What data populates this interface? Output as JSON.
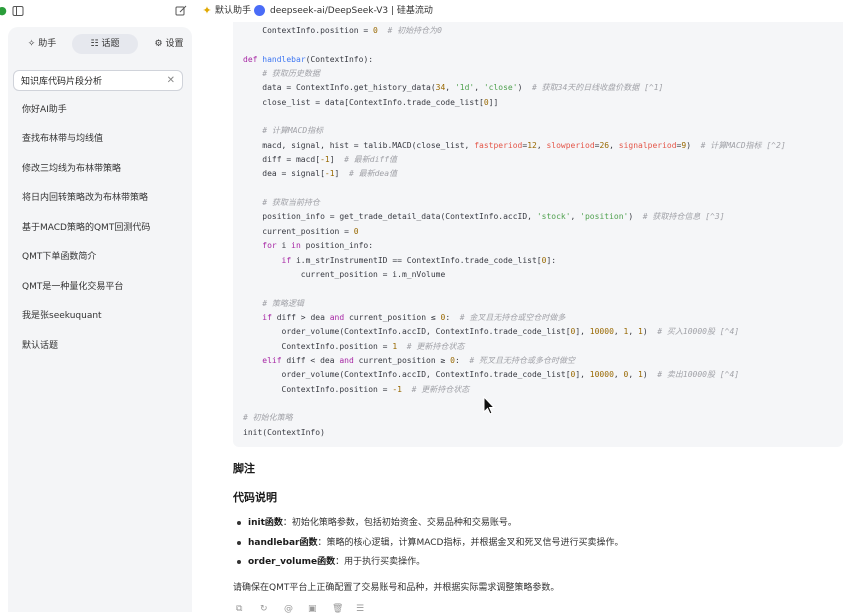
{
  "topbar": {
    "items": [
      {
        "icon": "edit-icon",
        "label": ""
      },
      {
        "icon": "star-icon",
        "label": "默认助手"
      },
      {
        "icon": "deepseek-logo-icon",
        "label": "deepseek-ai/DeepSeek-V3 | 硅基流动"
      }
    ]
  },
  "sidebar": {
    "tabs": [
      {
        "icon": "sparkle-icon",
        "label": "助手"
      },
      {
        "icon": "list-icon",
        "label": "话题"
      },
      {
        "icon": "gear-icon",
        "label": "设置"
      }
    ],
    "search": {
      "value": "知识库代码片段分析"
    },
    "conversations": [
      "你好AI助手",
      "查找布林带与均线值",
      "修改三均线为布林带策略",
      "将日内回转策略改为布林带策略",
      "基于MACD策略的QMT回测代码",
      "QMT下单函数简介",
      "QMT是一种量化交易平台",
      "我是张seekuquant",
      "默认话题"
    ]
  },
  "main": {
    "code_lines": [
      "    ContextInfo.position = 0  # 初始持仓为0",
      "",
      "def handlebar(ContextInfo):",
      "    # 获取历史数据",
      "    data = ContextInfo.get_history_data(34, '1d', 'close')  # 获取34天的日线收盘价数据 [^1]",
      "    close_list = data[ContextInfo.trade_code_list[0]]",
      "",
      "    # 计算MACD指标",
      "    macd, signal, hist = talib.MACD(close_list, fastperiod=12, slowperiod=26, signalperiod=9)  # 计算MACD指标 [^2]",
      "    diff = macd[-1]  # 最新diff值",
      "    dea = signal[-1]  # 最新dea值",
      "",
      "    # 获取当前持仓",
      "    position_info = get_trade_detail_data(ContextInfo.accID, 'stock', 'position')  # 获取持仓信息 [^3]",
      "    current_position = 0",
      "    for i in position_info:",
      "        if i.m_strInstrumentID == ContextInfo.trade_code_list[0]:",
      "            current_position = i.m_nVolume",
      "",
      "    # 策略逻辑",
      "    if diff > dea and current_position ≤ 0:  # 金叉且无持仓或空仓时做多",
      "        order_volume(ContextInfo.accID, ContextInfo.trade_code_list[0], 10000, 1, 1)  # 买入10000股 [^4]",
      "        ContextInfo.position = 1  # 更新持仓状态",
      "    elif diff < dea and current_position ≥ 0:  # 死叉且无持仓或多仓时做空",
      "        order_volume(ContextInfo.accID, ContextInfo.trade_code_list[0], 10000, 0, 1)  # 卖出10000股 [^4]",
      "        ContextInfo.position = -1  # 更新持仓状态",
      "",
      "# 初始化策略",
      "init(ContextInfo)"
    ],
    "note_heading": "脚注",
    "explain_heading": "代码说明",
    "bullets": [
      {
        "term": "init函数",
        "desc": "：初始化策略参数，包括初始资金、交易品种和交易账号。"
      },
      {
        "term": "handlebar函数",
        "desc": "：策略的核心逻辑，计算MACD指标，并根据金叉和死叉信号进行买卖操作。"
      },
      {
        "term": "order_volume函数",
        "desc": "：用于执行买卖操作。"
      }
    ],
    "footer": "请确保在QMT平台上正确配置了交易账号和品种，并根据实际需求调整策略参数。",
    "actions": [
      "copy-icon",
      "refresh-icon",
      "at-icon",
      "image-icon",
      "delete-icon",
      "menu-icon"
    ]
  }
}
